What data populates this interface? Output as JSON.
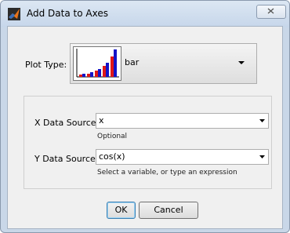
{
  "window": {
    "title": "Add Data to Axes"
  },
  "plot_type": {
    "label": "Plot Type:",
    "value": "bar",
    "icon": "bar-chart-thumbnail"
  },
  "x_source": {
    "label": "X Data Source:",
    "value": "x",
    "hint": "Optional"
  },
  "y_source": {
    "label": "Y Data Source:",
    "value": "cos(x)",
    "hint": "Select a variable, or type an expression"
  },
  "buttons": {
    "ok": "OK",
    "cancel": "Cancel"
  },
  "colors": {
    "bar_red": "#e01818",
    "bar_blue": "#1414c8",
    "titlebar": "#c6d6ea"
  }
}
